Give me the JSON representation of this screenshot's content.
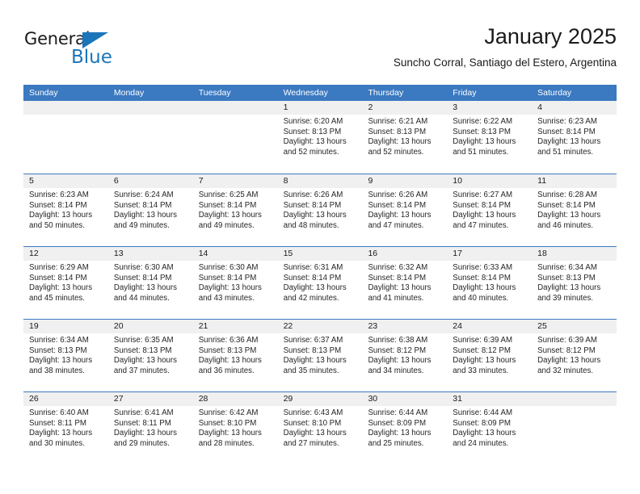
{
  "brand": {
    "name_part1": "General",
    "name_part2": "Blue",
    "triangle_icon": "triangle-icon",
    "accent_color": "#1b75bb"
  },
  "header": {
    "title": "January 2025",
    "subtitle": "Suncho Corral, Santiago del Estero, Argentina"
  },
  "calendar": {
    "header_color": "#3b79c0",
    "day_band_color": "#f0f0f0",
    "weekdays": [
      "Sunday",
      "Monday",
      "Tuesday",
      "Wednesday",
      "Thursday",
      "Friday",
      "Saturday"
    ],
    "weeks": [
      [
        {
          "day": "",
          "lines": []
        },
        {
          "day": "",
          "lines": []
        },
        {
          "day": "",
          "lines": []
        },
        {
          "day": "1",
          "lines": [
            "Sunrise: 6:20 AM",
            "Sunset: 8:13 PM",
            "Daylight: 13 hours",
            "and 52 minutes."
          ]
        },
        {
          "day": "2",
          "lines": [
            "Sunrise: 6:21 AM",
            "Sunset: 8:13 PM",
            "Daylight: 13 hours",
            "and 52 minutes."
          ]
        },
        {
          "day": "3",
          "lines": [
            "Sunrise: 6:22 AM",
            "Sunset: 8:13 PM",
            "Daylight: 13 hours",
            "and 51 minutes."
          ]
        },
        {
          "day": "4",
          "lines": [
            "Sunrise: 6:23 AM",
            "Sunset: 8:14 PM",
            "Daylight: 13 hours",
            "and 51 minutes."
          ]
        }
      ],
      [
        {
          "day": "5",
          "lines": [
            "Sunrise: 6:23 AM",
            "Sunset: 8:14 PM",
            "Daylight: 13 hours",
            "and 50 minutes."
          ]
        },
        {
          "day": "6",
          "lines": [
            "Sunrise: 6:24 AM",
            "Sunset: 8:14 PM",
            "Daylight: 13 hours",
            "and 49 minutes."
          ]
        },
        {
          "day": "7",
          "lines": [
            "Sunrise: 6:25 AM",
            "Sunset: 8:14 PM",
            "Daylight: 13 hours",
            "and 49 minutes."
          ]
        },
        {
          "day": "8",
          "lines": [
            "Sunrise: 6:26 AM",
            "Sunset: 8:14 PM",
            "Daylight: 13 hours",
            "and 48 minutes."
          ]
        },
        {
          "day": "9",
          "lines": [
            "Sunrise: 6:26 AM",
            "Sunset: 8:14 PM",
            "Daylight: 13 hours",
            "and 47 minutes."
          ]
        },
        {
          "day": "10",
          "lines": [
            "Sunrise: 6:27 AM",
            "Sunset: 8:14 PM",
            "Daylight: 13 hours",
            "and 47 minutes."
          ]
        },
        {
          "day": "11",
          "lines": [
            "Sunrise: 6:28 AM",
            "Sunset: 8:14 PM",
            "Daylight: 13 hours",
            "and 46 minutes."
          ]
        }
      ],
      [
        {
          "day": "12",
          "lines": [
            "Sunrise: 6:29 AM",
            "Sunset: 8:14 PM",
            "Daylight: 13 hours",
            "and 45 minutes."
          ]
        },
        {
          "day": "13",
          "lines": [
            "Sunrise: 6:30 AM",
            "Sunset: 8:14 PM",
            "Daylight: 13 hours",
            "and 44 minutes."
          ]
        },
        {
          "day": "14",
          "lines": [
            "Sunrise: 6:30 AM",
            "Sunset: 8:14 PM",
            "Daylight: 13 hours",
            "and 43 minutes."
          ]
        },
        {
          "day": "15",
          "lines": [
            "Sunrise: 6:31 AM",
            "Sunset: 8:14 PM",
            "Daylight: 13 hours",
            "and 42 minutes."
          ]
        },
        {
          "day": "16",
          "lines": [
            "Sunrise: 6:32 AM",
            "Sunset: 8:14 PM",
            "Daylight: 13 hours",
            "and 41 minutes."
          ]
        },
        {
          "day": "17",
          "lines": [
            "Sunrise: 6:33 AM",
            "Sunset: 8:14 PM",
            "Daylight: 13 hours",
            "and 40 minutes."
          ]
        },
        {
          "day": "18",
          "lines": [
            "Sunrise: 6:34 AM",
            "Sunset: 8:13 PM",
            "Daylight: 13 hours",
            "and 39 minutes."
          ]
        }
      ],
      [
        {
          "day": "19",
          "lines": [
            "Sunrise: 6:34 AM",
            "Sunset: 8:13 PM",
            "Daylight: 13 hours",
            "and 38 minutes."
          ]
        },
        {
          "day": "20",
          "lines": [
            "Sunrise: 6:35 AM",
            "Sunset: 8:13 PM",
            "Daylight: 13 hours",
            "and 37 minutes."
          ]
        },
        {
          "day": "21",
          "lines": [
            "Sunrise: 6:36 AM",
            "Sunset: 8:13 PM",
            "Daylight: 13 hours",
            "and 36 minutes."
          ]
        },
        {
          "day": "22",
          "lines": [
            "Sunrise: 6:37 AM",
            "Sunset: 8:13 PM",
            "Daylight: 13 hours",
            "and 35 minutes."
          ]
        },
        {
          "day": "23",
          "lines": [
            "Sunrise: 6:38 AM",
            "Sunset: 8:12 PM",
            "Daylight: 13 hours",
            "and 34 minutes."
          ]
        },
        {
          "day": "24",
          "lines": [
            "Sunrise: 6:39 AM",
            "Sunset: 8:12 PM",
            "Daylight: 13 hours",
            "and 33 minutes."
          ]
        },
        {
          "day": "25",
          "lines": [
            "Sunrise: 6:39 AM",
            "Sunset: 8:12 PM",
            "Daylight: 13 hours",
            "and 32 minutes."
          ]
        }
      ],
      [
        {
          "day": "26",
          "lines": [
            "Sunrise: 6:40 AM",
            "Sunset: 8:11 PM",
            "Daylight: 13 hours",
            "and 30 minutes."
          ]
        },
        {
          "day": "27",
          "lines": [
            "Sunrise: 6:41 AM",
            "Sunset: 8:11 PM",
            "Daylight: 13 hours",
            "and 29 minutes."
          ]
        },
        {
          "day": "28",
          "lines": [
            "Sunrise: 6:42 AM",
            "Sunset: 8:10 PM",
            "Daylight: 13 hours",
            "and 28 minutes."
          ]
        },
        {
          "day": "29",
          "lines": [
            "Sunrise: 6:43 AM",
            "Sunset: 8:10 PM",
            "Daylight: 13 hours",
            "and 27 minutes."
          ]
        },
        {
          "day": "30",
          "lines": [
            "Sunrise: 6:44 AM",
            "Sunset: 8:09 PM",
            "Daylight: 13 hours",
            "and 25 minutes."
          ]
        },
        {
          "day": "31",
          "lines": [
            "Sunrise: 6:44 AM",
            "Sunset: 8:09 PM",
            "Daylight: 13 hours",
            "and 24 minutes."
          ]
        },
        {
          "day": "",
          "lines": []
        }
      ]
    ]
  }
}
